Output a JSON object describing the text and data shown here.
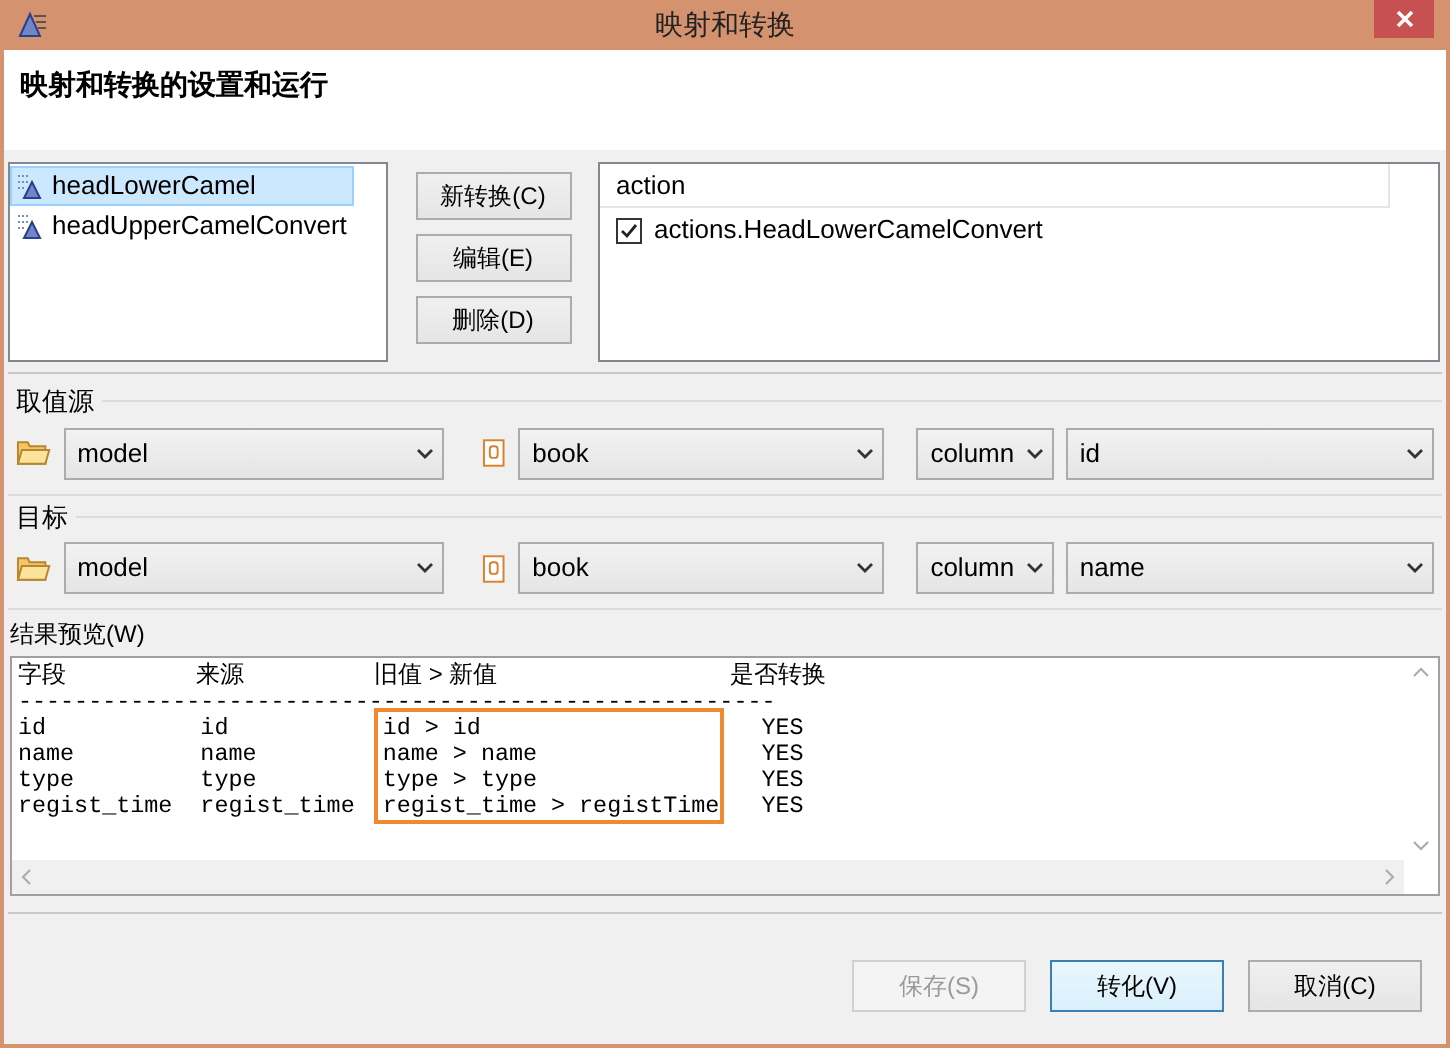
{
  "window": {
    "title": "映射和转换"
  },
  "header": {
    "title": "映射和转换的设置和运行"
  },
  "conversions": [
    {
      "label": "headLowerCamel",
      "selected": true
    },
    {
      "label": "headUpperCamelConvert",
      "selected": false
    }
  ],
  "actions_buttons": [
    "新转换(C)",
    "编辑(E)",
    "删除(D)"
  ],
  "action_table": {
    "column": "action",
    "rows": [
      {
        "label": "actions.HeadLowerCamelConvert",
        "checked": true
      }
    ]
  },
  "source": {
    "label": "取值源",
    "model": "model",
    "table": "book",
    "kind": "column",
    "field": "id"
  },
  "target": {
    "label": "目标",
    "model": "model",
    "table": "book",
    "kind": "column",
    "field": "name"
  },
  "preview": {
    "label": "结果预览(W)",
    "header_labels": [
      "字段",
      "来源",
      "旧值 > 新值",
      "是否转换"
    ],
    "lines": [
      "------------------------------------------------------",
      "id           id           id > id                    YES",
      "name         name         name > name                YES",
      "type         type         type > type                YES",
      "regist_time  regist_time  regist_time > registTime   YES"
    ]
  },
  "footer_buttons": [
    {
      "label": "保存(S)",
      "disabled": true,
      "default": false
    },
    {
      "label": "转化(V)",
      "disabled": false,
      "default": true
    },
    {
      "label": "取消(C)",
      "disabled": false,
      "default": false
    }
  ]
}
